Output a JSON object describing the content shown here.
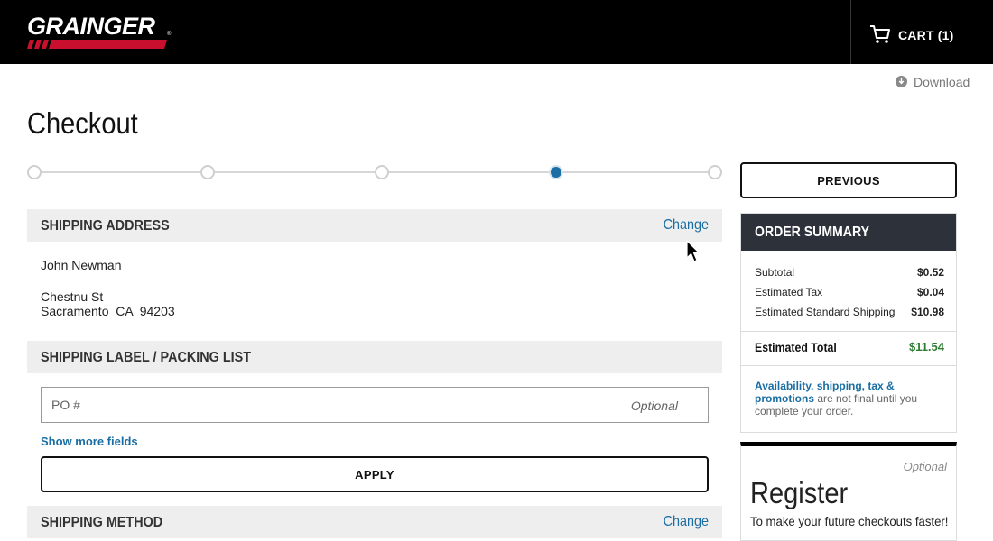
{
  "header": {
    "logo_text": "GRAINGER",
    "logo_reg": "®",
    "cart_label": "CART (1)",
    "colors": {
      "background": "#000000",
      "logo_accent": "#c8102e"
    }
  },
  "toolbar": {
    "download_label": "Download",
    "download_icon": "download-icon"
  },
  "page": {
    "title": "Checkout"
  },
  "progress": {
    "total_steps": 5,
    "active_step": 4,
    "active_color": "#1a6ea3"
  },
  "shipping_address": {
    "title": "SHIPPING ADDRESS",
    "change_label": "Change",
    "name": "John Newman",
    "street": "Chestnu St",
    "city_line": "Sacramento  CA  94203"
  },
  "shipping_label": {
    "title": "SHIPPING LABEL / PACKING LIST",
    "po_placeholder": "PO #",
    "po_value": "",
    "optional_label": "Optional",
    "show_more_label": "Show more fields",
    "apply_label": "APPLY"
  },
  "shipping_method": {
    "title": "SHIPPING METHOD",
    "change_label": "Change"
  },
  "sidebar": {
    "previous_label": "PREVIOUS",
    "summary": {
      "title": "ORDER SUMMARY",
      "rows": [
        {
          "label": "Subtotal",
          "value": "$0.52"
        },
        {
          "label": "Estimated Tax",
          "value": "$0.04"
        },
        {
          "label": "Estimated Standard Shipping",
          "value": "$10.98"
        }
      ],
      "total_label": "Estimated Total",
      "total_value": "$11.54",
      "note_highlight": "Availability, shipping, tax & promotions",
      "note_rest": " are not final until you complete your order."
    },
    "register": {
      "optional_label": "Optional",
      "title": "Register",
      "subtitle": "To make your future checkouts faster!"
    }
  }
}
